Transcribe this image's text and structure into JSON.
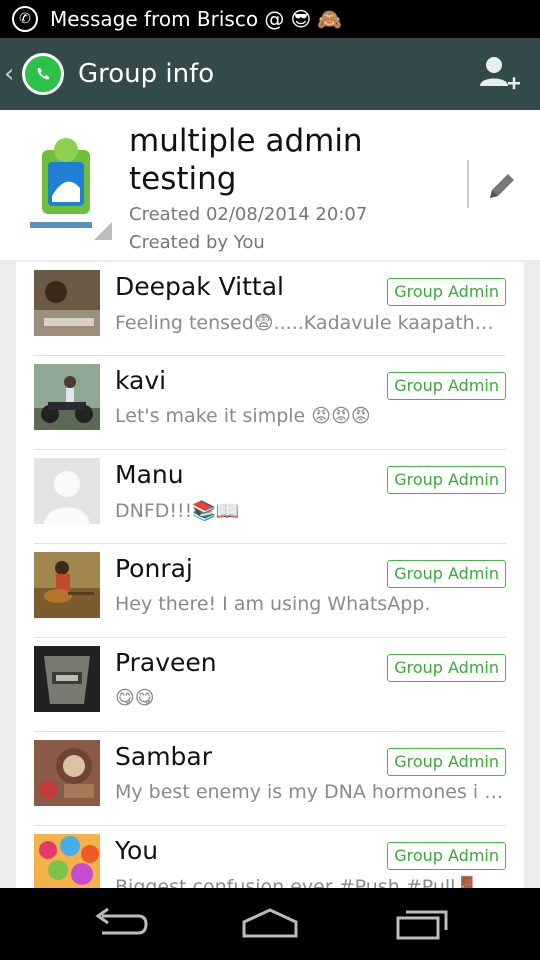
{
  "status_bar": {
    "notification_text": "Message from Brisco @",
    "emojis": [
      "😎",
      "🙈"
    ]
  },
  "action_bar": {
    "title": "Group info",
    "icons": [
      "back-chevron-icon",
      "whatsapp-logo-icon",
      "add-participant-icon"
    ]
  },
  "group": {
    "name": "multiple admin testing",
    "created_at": "Created 02/08/2014 20:07",
    "created_by": "Created by You",
    "edit_icon": "pencil-icon"
  },
  "members": [
    {
      "name": "Deepak Vittal",
      "status": "Feeling tensed😨.....Kadavule kaapathu🙏",
      "badge": "Group Admin"
    },
    {
      "name": "kavi",
      "status": "Let's make it simple 😡😡😡",
      "badge": "Group Admin"
    },
    {
      "name": "Manu",
      "status": "DNFD!!!📚📖",
      "badge": "Group Admin"
    },
    {
      "name": "Ponraj",
      "status": "Hey there! I am using WhatsApp.",
      "badge": "Group Admin"
    },
    {
      "name": "Praveen",
      "status": "😋😋",
      "badge": "Group Admin"
    },
    {
      "name": "Sambar",
      "status": "My best enemy is my DNA hormones i s...",
      "badge": "Group Admin"
    },
    {
      "name": "You",
      "status": "Biggest confusion ever #Push #Pull🚪",
      "badge": "Group Admin"
    }
  ],
  "nav_bar": {
    "icons": [
      "back-icon",
      "home-icon",
      "recent-apps-icon"
    ]
  },
  "colors": {
    "action_bar": "#34494a",
    "accent_green": "#3aa93a",
    "whatsapp_green": "#2ec14a"
  }
}
